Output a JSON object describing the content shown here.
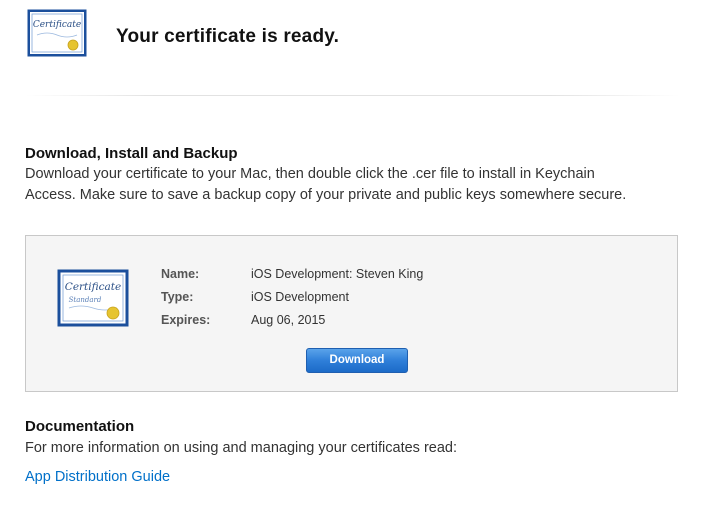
{
  "header": {
    "title": "Your certificate is ready.",
    "icon_text": "Certificate"
  },
  "download_section": {
    "title": "Download, Install and Backup",
    "description_line1": "Download your certificate to your Mac, then double click the .cer file to install in Keychain",
    "description_line2": "Access. Make sure to save a backup copy of your private and public keys somewhere secure."
  },
  "certificate": {
    "icon_text": "Certificate",
    "icon_subtext": "Standard",
    "name_label": "Name:",
    "name_value": "iOS Development: Steven King",
    "type_label": "Type:",
    "type_value": "iOS Development",
    "expires_label": "Expires:",
    "expires_value": "Aug 06, 2015",
    "download_label": "Download"
  },
  "documentation": {
    "title": "Documentation",
    "description": "For more information on using and managing your certificates read:",
    "link_label": "App Distribution Guide"
  },
  "colors": {
    "link": "#0070c9",
    "button": "#2f7fd9",
    "certificate_border": "#1b4f9c",
    "seal": "#e6c430"
  }
}
